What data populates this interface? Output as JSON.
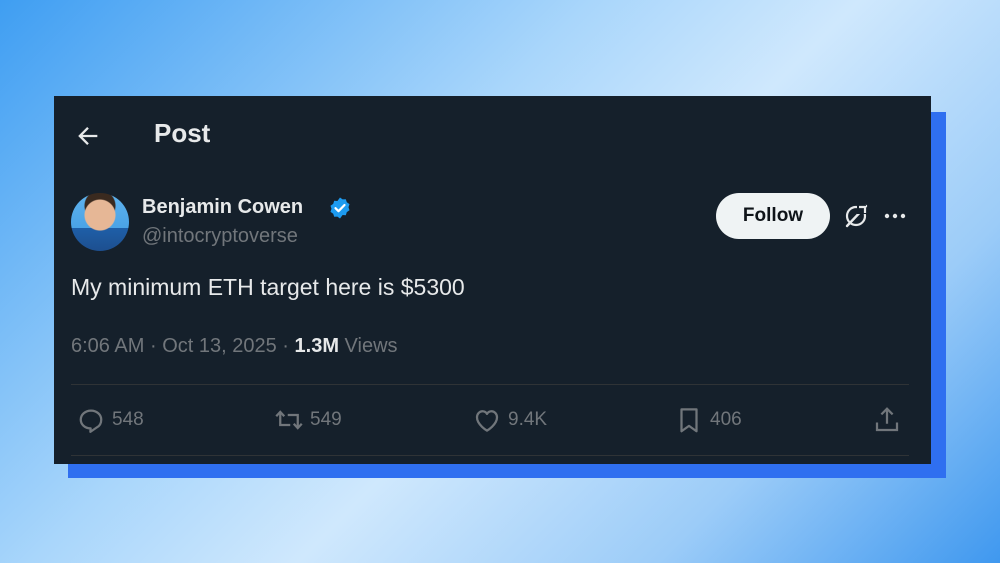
{
  "header": {
    "title": "Post"
  },
  "post": {
    "author_name": "Benjamin Cowen",
    "handle": "@intocryptoverse",
    "follow_label": "Follow",
    "text": "My minimum ETH target here is $5300",
    "time": "6:06 AM",
    "separator": "·",
    "date": "Oct 13, 2025",
    "views_count": "1.3M",
    "views_label": "Views"
  },
  "actions": {
    "replies": "548",
    "reposts": "549",
    "likes": "9.4K",
    "bookmarks": "406"
  },
  "colors": {
    "card_bg": "#15202b",
    "verified": "#1d9bf0",
    "muted": "#71767b",
    "shadow": "#2f6ff0"
  },
  "icons": [
    "back-arrow-icon",
    "verified-badge-icon",
    "grok-icon",
    "more-icon",
    "reply-icon",
    "repost-icon",
    "like-icon",
    "bookmark-icon",
    "share-icon"
  ]
}
